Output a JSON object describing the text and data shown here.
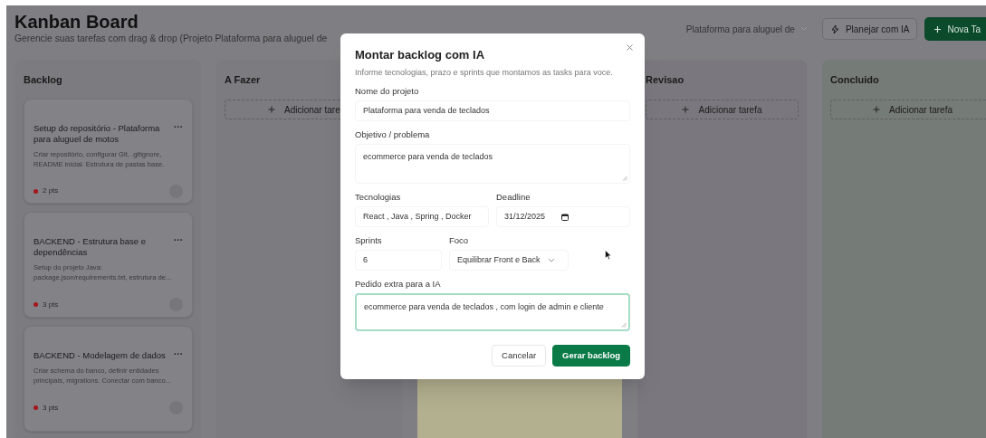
{
  "header": {
    "title": "Kanban Board",
    "subtitle": "Gerencie suas tarefas com drag & drop (Projeto Plataforma para aluguel de",
    "project_select": "Plataforma para aluguel de",
    "plan_button": "Planejar com IA",
    "new_task_button": "Nova Ta"
  },
  "columns": [
    {
      "title": "Backlog",
      "color": "#7c7b80",
      "cards": [
        {
          "title": "Setup do repositório - Plataforma para aluguel de motos",
          "menu": "···",
          "description": "Criar repositório, configurar Git, .gitignore, README inicial. Estrutura de pastas base.",
          "points": "2 pts",
          "color": "#a3161c"
        },
        {
          "title": "BACKEND - Estrutura base e dependências",
          "menu": "···",
          "description": "Setup do projeto Java: package.json/requirements.txt, estrutura de...",
          "points": "3 pts",
          "color": "#a3161c"
        },
        {
          "title": "BACKEND - Modelagem de dados",
          "menu": "···",
          "description": "Criar schema do banco, definir entidades principais, migrations. Conectar com banco...",
          "points": "3 pts",
          "color": "#a3161c"
        }
      ]
    },
    {
      "title": "A Fazer",
      "color": "#7c7b80",
      "add_label": "Adicionar tare"
    },
    {
      "color": "#b3b08f"
    },
    {
      "title": "Revisao",
      "color": "#7a787e",
      "add_label": "Adicionar tarefa"
    },
    {
      "title": "Concluido",
      "color": "#757b77",
      "add_label": "Adicionar tarefa"
    }
  ],
  "modal": {
    "title": "Montar backlog com IA",
    "subtitle": "Informe tecnologias, prazo e sprints que montamos as tasks para voce.",
    "rows": [
      [
        {
          "kind": "text",
          "label": "Nome do projeto",
          "value": "Plataforma para venda de teclados",
          "focused": false
        }
      ],
      [
        {
          "kind": "textarea",
          "label": "Objetivo / problema",
          "value": "ecommerce para venda de teclados",
          "focused": false
        }
      ],
      [
        {
          "kind": "text",
          "label": "Tecnologias",
          "value": "React , Java , Spring , Docker",
          "focused": false
        },
        {
          "kind": "date",
          "label": "Deadline",
          "value": "31/12/2025",
          "focused": false
        }
      ],
      [
        {
          "kind": "number",
          "label": "Sprints",
          "value": "6",
          "focused": false
        },
        {
          "kind": "select",
          "label": "Foco",
          "value": "Equilibrar Front e Back",
          "focused": false
        }
      ],
      [
        {
          "kind": "textarea",
          "label": "Pedido extra para a IA",
          "value": "ecommerce para venda de teclados , com login de admin e cliente",
          "focused": true
        }
      ]
    ],
    "buttons": [
      {
        "kind": "secondary",
        "label": "Cancelar"
      },
      {
        "kind": "primary",
        "label": "Gerar backlog"
      }
    ]
  }
}
